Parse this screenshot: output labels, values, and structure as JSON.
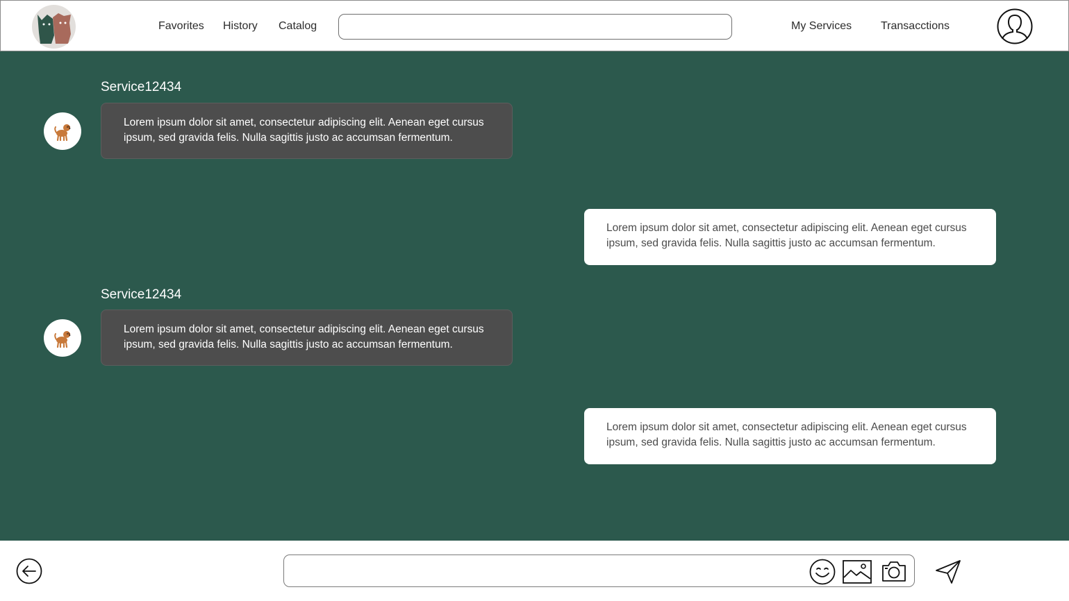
{
  "header": {
    "nav_left": [
      "Favorites",
      "History",
      "Catalog"
    ],
    "search_placeholder": "",
    "nav_right": [
      "My Services",
      "Transacctions"
    ],
    "logo_icon": "two-pets-logo",
    "profile_icon": "user-profile-icon"
  },
  "chat": {
    "background": "#2c594d",
    "messages": [
      {
        "direction": "incoming",
        "sender": "Service12434",
        "avatar_icon": "dog-icon",
        "text": "Lorem ipsum dolor sit amet, consectetur adipiscing elit. Aenean eget cursus ipsum, sed gravida felis. Nulla sagittis justo ac accumsan fermentum."
      },
      {
        "direction": "outgoing",
        "text": "Lorem ipsum dolor sit amet, consectetur adipiscing elit. Aenean eget cursus ipsum, sed gravida felis. Nulla sagittis justo ac accumsan fermentum."
      },
      {
        "direction": "incoming",
        "sender": "Service12434",
        "avatar_icon": "dog-icon",
        "text": "Lorem ipsum dolor sit amet, consectetur adipiscing elit. Aenean eget cursus ipsum, sed gravida felis. Nulla sagittis justo ac accumsan fermentum."
      },
      {
        "direction": "outgoing",
        "text": "Lorem ipsum dolor sit amet, consectetur adipiscing elit. Aenean eget cursus ipsum, sed gravida felis. Nulla sagittis justo ac accumsan fermentum."
      }
    ]
  },
  "footer": {
    "back_icon": "back-arrow-icon",
    "compose_placeholder": "",
    "compose_icons": [
      "emoji-icon",
      "image-icon",
      "camera-icon"
    ],
    "send_icon": "send-icon"
  }
}
